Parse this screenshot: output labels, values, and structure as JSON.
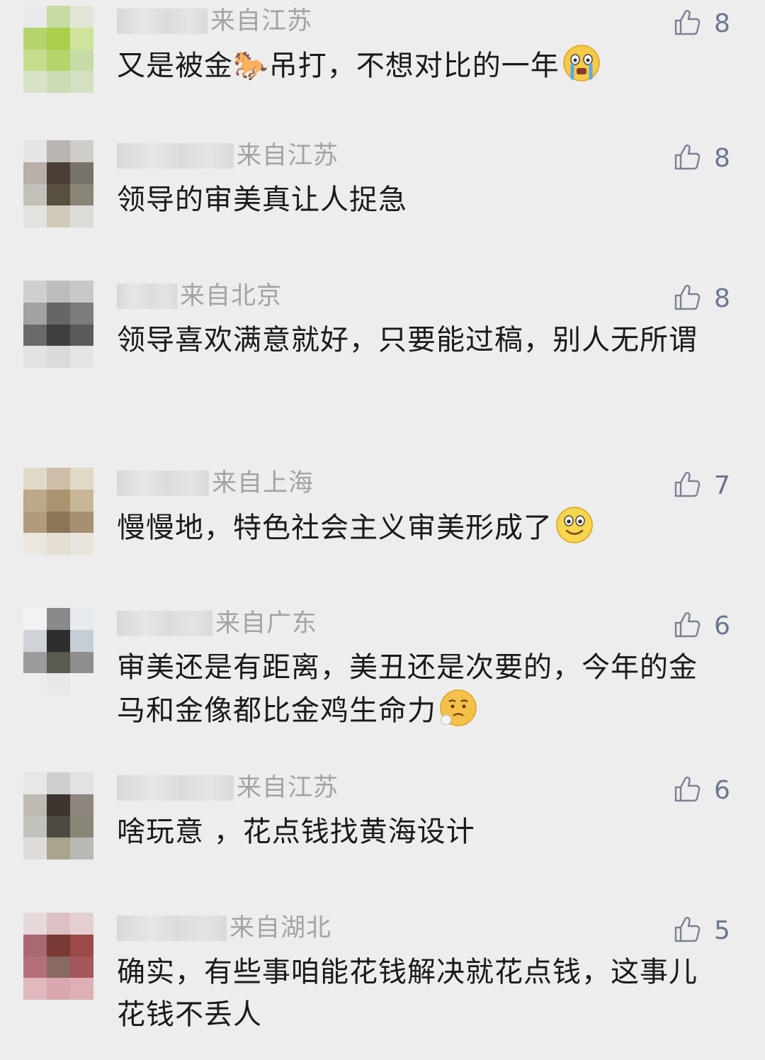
{
  "comments": [
    {
      "location": "来自江苏",
      "likes": "8",
      "text": "又是被金🐎吊打，不想对比的一年",
      "emoji": "crying-face-icon",
      "avatar_colors": [
        "#eaeaea",
        "#c7dba2",
        "#e1e6d6",
        "#b5d56b",
        "#a9cf4b",
        "#cfe39d",
        "#c4dc8c",
        "#b6d46c",
        "#c7dba6",
        "#d8e2c6",
        "#cbdcb4",
        "#d3e1c2"
      ]
    },
    {
      "location": "来自江苏",
      "likes": "8",
      "text": "领导的审美真让人捉急",
      "emoji": "",
      "avatar_colors": [
        "#e6e6e6",
        "#b9b6b1",
        "#cfcdca",
        "#b7b0a8",
        "#4a3f37",
        "#77736a",
        "#c4c0ba",
        "#58503f",
        "#8a8675",
        "#e3e2df",
        "#cfcbb8",
        "#dcdcd8"
      ]
    },
    {
      "location": "来自北京",
      "likes": "8",
      "text": "领导喜欢满意就好，只要能过稿，别人无所谓",
      "emoji": "",
      "avatar_colors": [
        "#cfcfcf",
        "#bdbdbd",
        "#c8c8c8",
        "#a2a2a2",
        "#666666",
        "#7b7b7b",
        "#6a6a6a",
        "#3e3e3e",
        "#5a5a5a",
        "#e2e2e2",
        "#dadada",
        "#e4e4e4"
      ]
    },
    {
      "location": "来自上海",
      "likes": "7",
      "text": "慢慢地，特色社会主义审美形成了",
      "emoji": "smiling-face-icon",
      "avatar_colors": [
        "#e1dacb",
        "#cdbfa7",
        "#e0d9c8",
        "#bca88a",
        "#a9946f",
        "#c8b797",
        "#b09b7d",
        "#8e7557",
        "#a68f72",
        "#ebe7e0",
        "#e4ded3",
        "#e8e3db"
      ]
    },
    {
      "location": "来自广东",
      "likes": "6",
      "text": "审美还是有距离，美丑还是次要的，今年的金马和金像都比金鸡生命力",
      "emoji": "disappointed-face-icon",
      "avatar_colors": [
        "#f2f2f2",
        "#8a8a8a",
        "#e6eaee",
        "#d0d4d8",
        "#2e2e2e",
        "#c5ced6",
        "#9a9c9e",
        "#5a5a4e",
        "#8e8e8e",
        "#ededed",
        "#e8e8e8",
        "#eeeeee"
      ]
    },
    {
      "location": "来自江苏",
      "likes": "6",
      "text": "啥玩意 ，花点钱找黄海设计",
      "emoji": "",
      "avatar_colors": [
        "#e7e7e7",
        "#cfcfcf",
        "#e2e2e2",
        "#bfb9b3",
        "#3f3530",
        "#8c867e",
        "#c2c1bc",
        "#4e4a42",
        "#8a8677",
        "#dedddb",
        "#aaa38e",
        "#b8bab3"
      ]
    },
    {
      "location": "来自湖北",
      "likes": "5",
      "text": "确实，有些事咱能花钱解决就花点钱，这事儿花钱不丢人",
      "emoji": "",
      "avatar_colors": [
        "#e7d8da",
        "#dcc0c4",
        "#e3cfd2",
        "#a86a70",
        "#7a3a34",
        "#9a4a48",
        "#b4707a",
        "#8a6a60",
        "#a4585c",
        "#e2b8bf",
        "#d8a8ae",
        "#dcb0b6"
      ]
    }
  ],
  "colors": {
    "background": "#ededed",
    "location": "#a3a3a3",
    "like_icon": "#7a8194",
    "like_count": "#6b7690",
    "text": "#1a1a1a"
  }
}
